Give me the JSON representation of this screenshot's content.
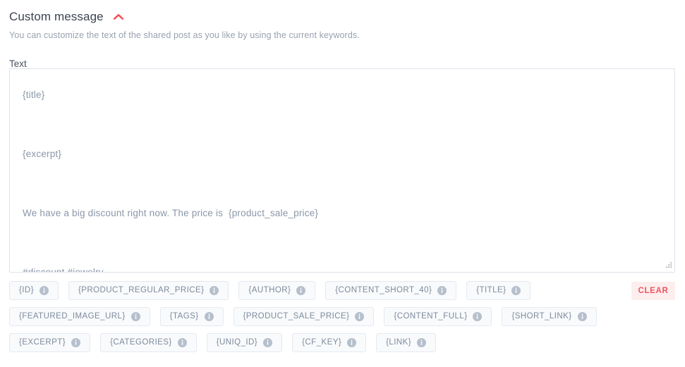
{
  "panel": {
    "title": "Custom message",
    "subtitle": "You can customize the text of the shared post as you like by using the current keywords.",
    "collapse_icon": "chevron-up-icon",
    "accent_color": "#f0555f"
  },
  "field": {
    "label": "Text",
    "value": "{title}\n\n{excerpt}\n\nWe have a big discount right now. The price is  {product_sale_price}\n\n#discount #jewelry",
    "placeholder": "",
    "text_color": "#8a97a8",
    "border_color": "#dde3ea"
  },
  "keywords": {
    "info_icon": "info-circle-icon",
    "chips": [
      {
        "label": "{ID}"
      },
      {
        "label": "{PRODUCT_REGULAR_PRICE}"
      },
      {
        "label": "{AUTHOR}"
      },
      {
        "label": "{CONTENT_SHORT_40}"
      },
      {
        "label": "{TITLE}"
      },
      {
        "label": "{FEATURED_IMAGE_URL}"
      },
      {
        "label": "{TAGS}"
      },
      {
        "label": "{PRODUCT_SALE_PRICE}"
      },
      {
        "label": "{CONTENT_FULL}"
      },
      {
        "label": "{SHORT_LINK}"
      },
      {
        "label": "{EXCERPT}"
      },
      {
        "label": "{CATEGORIES}"
      },
      {
        "label": "{UNIQ_ID}"
      },
      {
        "label": "{CF_KEY}"
      },
      {
        "label": "{LINK}"
      }
    ]
  },
  "actions": {
    "clear_label": "CLEAR",
    "clear_bg": "#fdeeee",
    "clear_color": "#f0555f"
  }
}
